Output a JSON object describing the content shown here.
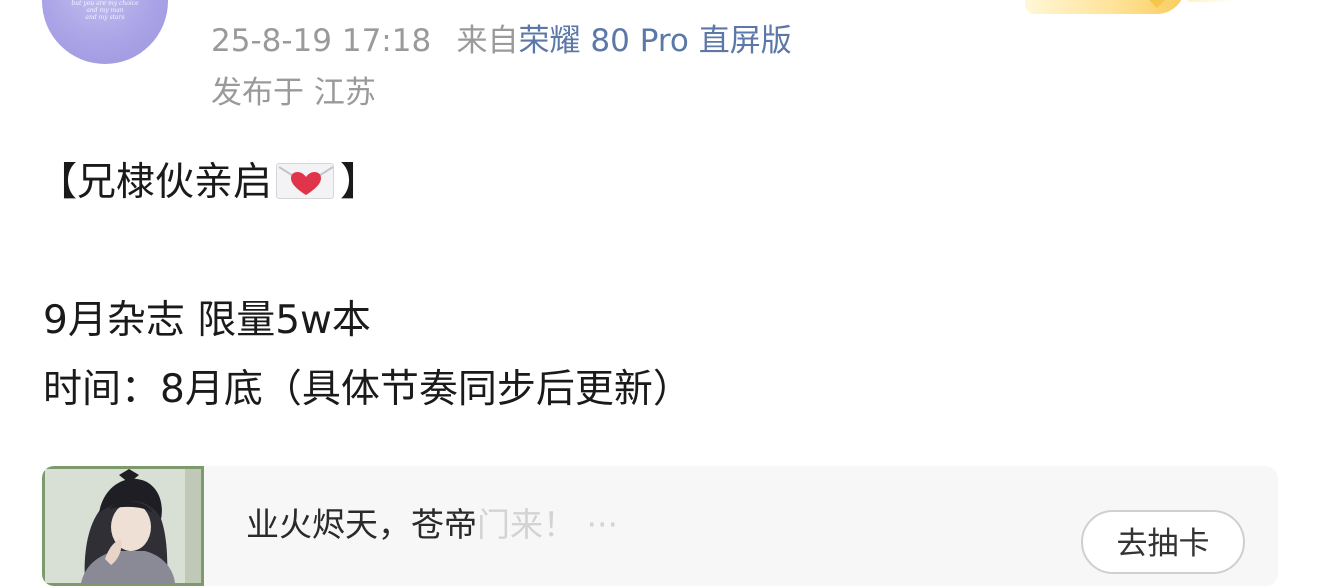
{
  "avatar": {
    "caption": "but you are my choice\nand my man\nand my stars"
  },
  "meta": {
    "date": "25-8-19 17:18",
    "source_prefix": "来自",
    "device": "荣耀 80 Pro 直屏版",
    "location": "发布于 江苏"
  },
  "post": {
    "heading_open": "【兄棣伙亲启",
    "heading_close": "】",
    "line2": "9月杂志  限量5w本",
    "line3": "时间：8月底（具体节奏同步后更新）"
  },
  "card": {
    "title_visible": "业火烬天，苍帝",
    "title_blurred": "门来！ ···",
    "button_label": "去抽卡"
  },
  "colors": {
    "meta_text": "#9a9a9a",
    "device_link": "#5b78a8",
    "avatar_bg": "#aaa3e6",
    "card_bg": "#f7f7f7",
    "heart": "#e0344a"
  },
  "icons": {
    "envelope": "love-letter-icon"
  }
}
